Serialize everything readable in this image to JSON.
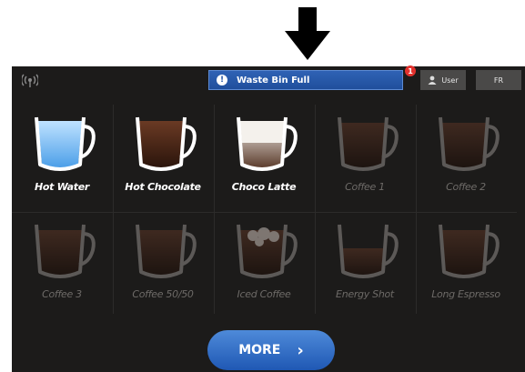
{
  "alert": {
    "text": "Waste Bin Full",
    "badge": "1",
    "icon": "exclamation-icon"
  },
  "header": {
    "user_label": "User",
    "lang_label": "FR",
    "wifi_icon": "wifi-signal-icon"
  },
  "drinks": [
    {
      "label": "Hot Water",
      "enabled": true,
      "fill": "water"
    },
    {
      "label": "Hot Chocolate",
      "enabled": true,
      "fill": "chocolate"
    },
    {
      "label": "Choco Latte",
      "enabled": true,
      "fill": "latte"
    },
    {
      "label": "Coffee 1",
      "enabled": false,
      "fill": "coffee"
    },
    {
      "label": "Coffee 2",
      "enabled": false,
      "fill": "coffee"
    },
    {
      "label": "Coffee 3",
      "enabled": false,
      "fill": "coffee"
    },
    {
      "label": "Coffee 50/50",
      "enabled": false,
      "fill": "coffee"
    },
    {
      "label": "Iced Coffee",
      "enabled": false,
      "fill": "iced"
    },
    {
      "label": "Energy Shot",
      "enabled": false,
      "fill": "shot"
    },
    {
      "label": "Long Espresso",
      "enabled": false,
      "fill": "coffee"
    }
  ],
  "more_button": {
    "label": "MORE",
    "chevron": "›"
  },
  "colors": {
    "accent": "#2a5fb8",
    "background": "#1c1b1a",
    "alert_badge": "#e3322e"
  }
}
